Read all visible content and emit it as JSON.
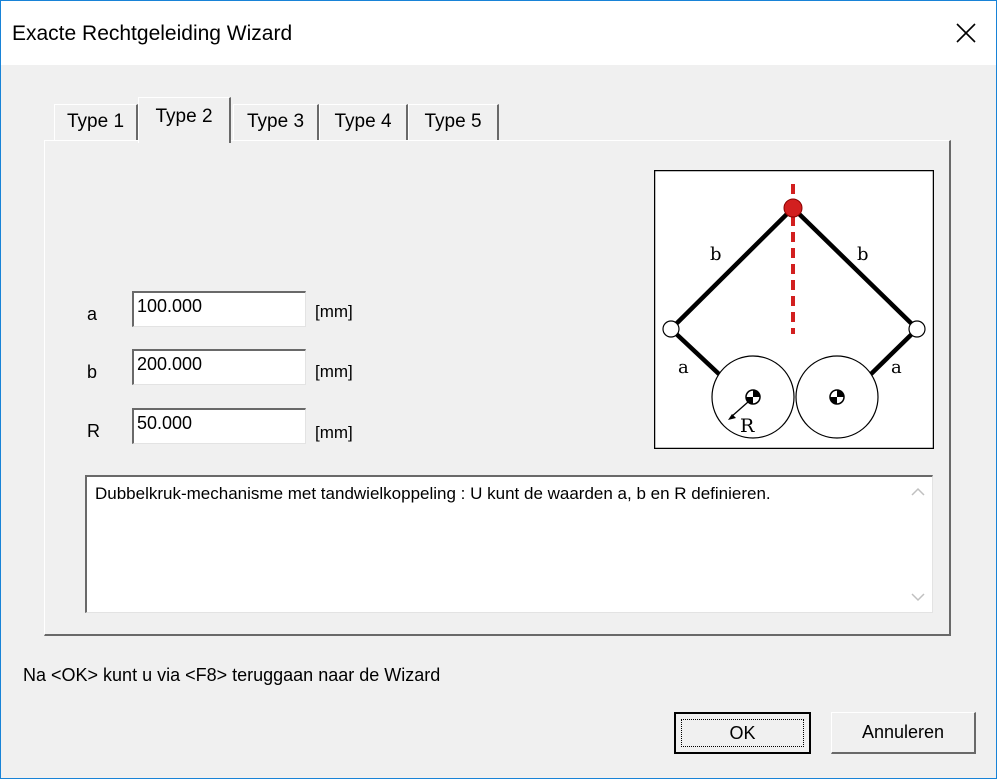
{
  "window": {
    "title": "Exacte Rechtgeleiding Wizard",
    "close_icon": "close-icon"
  },
  "tabs": [
    {
      "label": "Type 1",
      "active": false
    },
    {
      "label": "Type 2",
      "active": true
    },
    {
      "label": "Type 3",
      "active": false
    },
    {
      "label": "Type 4",
      "active": false
    },
    {
      "label": "Type 5",
      "active": false
    }
  ],
  "fields": {
    "a": {
      "label": "a",
      "value": "100.000",
      "unit": "[mm]"
    },
    "b": {
      "label": "b",
      "value": "200.000",
      "unit": "[mm]"
    },
    "r": {
      "label": "R",
      "value": "50.000",
      "unit": "[mm]"
    }
  },
  "diagram": {
    "labels": {
      "b_left": "b",
      "b_right": "b",
      "a_left": "a",
      "a_right": "a",
      "r": "R"
    },
    "accent_color": "#d21f1f"
  },
  "description": "Dubbelkruk-mechanisme met tandwielkoppeling : U kunt de waarden a, b en R definieren.",
  "footer": {
    "hint": "Na <OK> kunt u via <F8> teruggaan naar de Wizard",
    "ok_label": "OK",
    "cancel_label": "Annuleren"
  }
}
